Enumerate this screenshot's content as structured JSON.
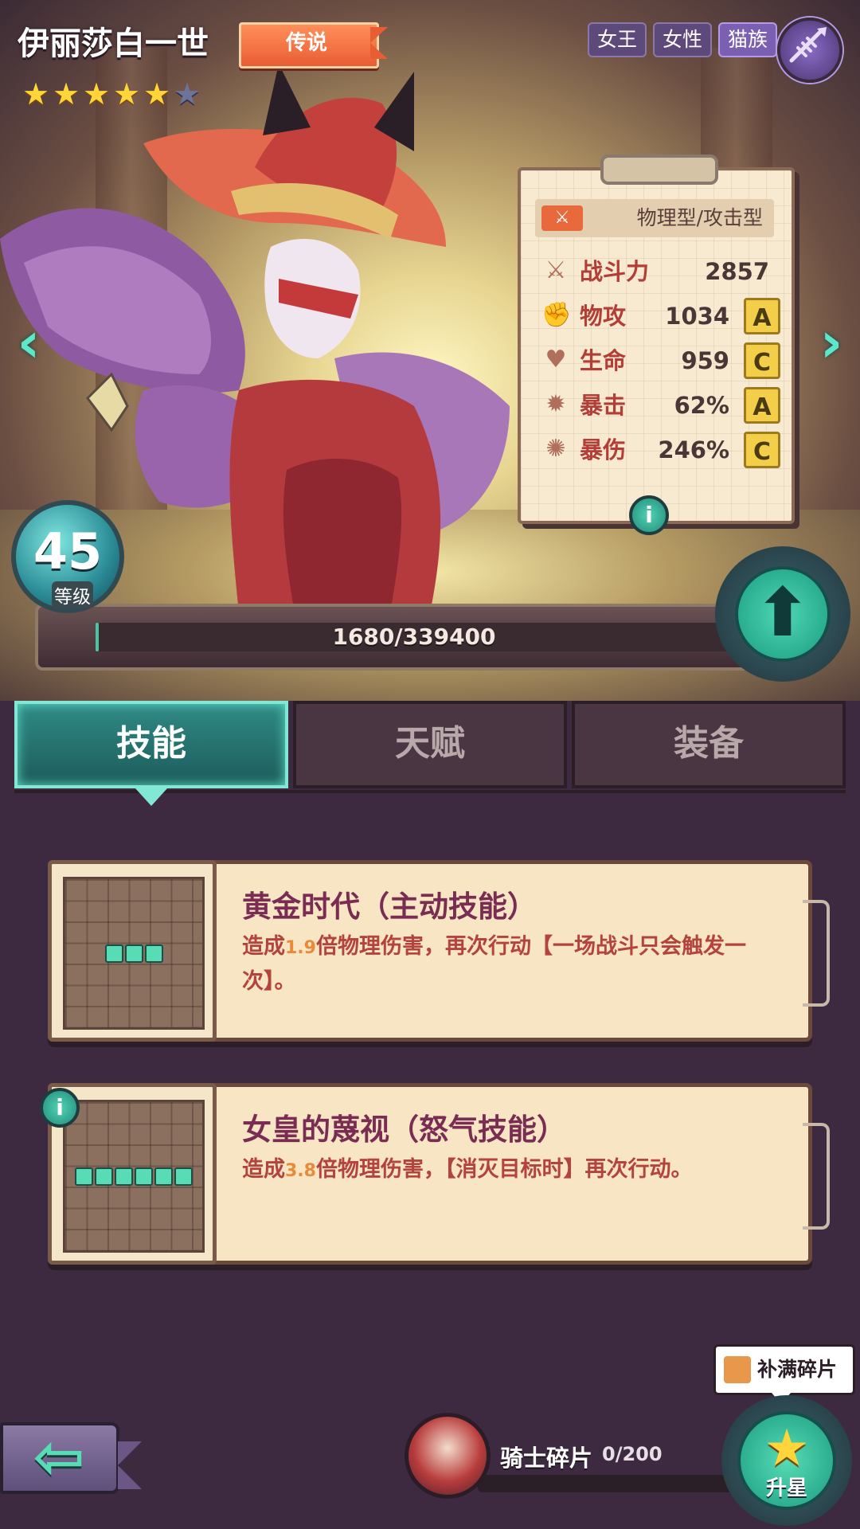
{
  "hero": {
    "name": "伊丽莎白一世",
    "rarity": "传说",
    "stars_total": 6,
    "stars_filled": 5,
    "tags": [
      "女王",
      "女性",
      "猫族"
    ]
  },
  "stats": {
    "type": "物理型/攻击型",
    "rows": [
      {
        "label": "战斗力",
        "value": "2857",
        "grade": ""
      },
      {
        "label": "物攻",
        "value": "1034",
        "grade": "A"
      },
      {
        "label": "生命",
        "value": "959",
        "grade": "C"
      },
      {
        "label": "暴击",
        "value": "62%",
        "grade": "A"
      },
      {
        "label": "暴伤",
        "value": "246%",
        "grade": "C"
      }
    ]
  },
  "level": {
    "value": "45",
    "label": "等级",
    "exp_text": "1680/339400",
    "exp_fraction": 0.005
  },
  "tabs": [
    {
      "label": "技能",
      "active": true
    },
    {
      "label": "天赋",
      "active": false
    },
    {
      "label": "装备",
      "active": false
    }
  ],
  "skills": [
    {
      "title": "黄金时代（主动技能）",
      "desc_pre": "造成",
      "desc_num": "1.9",
      "desc_post": "倍物理伤害，再次行动【一场战斗只会触发一次】。",
      "blocks": 3
    },
    {
      "title": "女皇的蔑视（怒气技能）",
      "desc_pre": "造成",
      "desc_num": "3.8",
      "desc_post": "倍物理伤害，【消灭目标时】再次行动。",
      "blocks": 6
    }
  ],
  "bottom": {
    "shard_label": "骑士碎片",
    "shard_count": "0/200",
    "fill_tip": "补满碎片",
    "starup_label": "升星"
  },
  "colors": {
    "accent_teal": "#57dcb5",
    "grade_yellow": "#f3cf49",
    "stat_label_red": "#b33d37",
    "rarity_orange": "#e95d34"
  },
  "icons": {
    "type": "sword-icon",
    "power": "crossed-swords-icon",
    "attack": "fist-icon",
    "hp": "heart-icon",
    "crit": "crit-icon",
    "critdmg": "splash-icon",
    "race": "fish-bone-icon"
  }
}
